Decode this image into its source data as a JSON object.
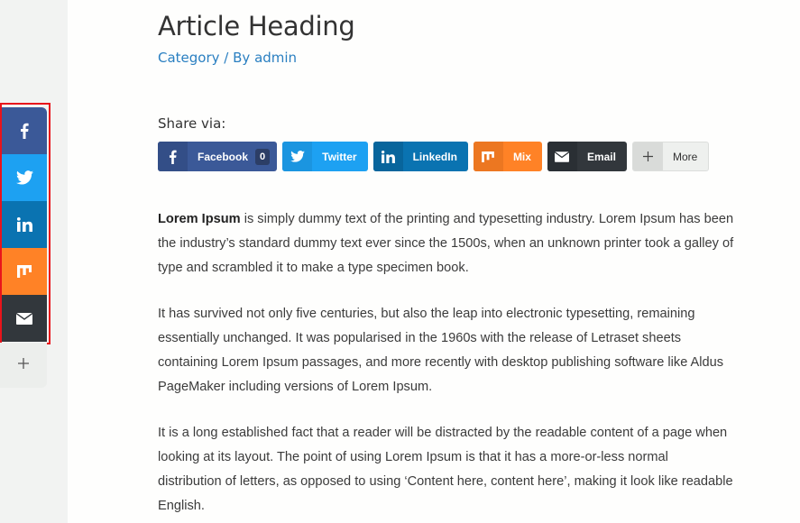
{
  "article": {
    "title": "Article Heading",
    "category": "Category",
    "separator": " / By ",
    "author": "admin"
  },
  "share": {
    "label": "Share via:",
    "buttons": [
      {
        "name": "Facebook",
        "label": "Facebook",
        "count": "0",
        "color": "#3b5998",
        "icon": "facebook-icon"
      },
      {
        "name": "Twitter",
        "label": "Twitter",
        "color": "#1da1f2",
        "icon": "twitter-icon"
      },
      {
        "name": "LinkedIn",
        "label": "LinkedIn",
        "color": "#0a73b1",
        "icon": "linkedin-icon"
      },
      {
        "name": "Mix",
        "label": "Mix",
        "color": "#ff8226",
        "icon": "mix-icon"
      },
      {
        "name": "Email",
        "label": "Email",
        "color": "#32373c",
        "icon": "email-icon"
      },
      {
        "name": "More",
        "label": "More",
        "color": "#eef0ee",
        "icon": "plus-icon"
      }
    ]
  },
  "floating_bar": {
    "buttons": [
      {
        "name": "Facebook",
        "icon": "facebook-icon",
        "color": "#3b5998"
      },
      {
        "name": "Twitter",
        "icon": "twitter-icon",
        "color": "#1da1f2"
      },
      {
        "name": "LinkedIn",
        "icon": "linkedin-icon",
        "color": "#0a73b1"
      },
      {
        "name": "Mix",
        "icon": "mix-icon",
        "color": "#ff8226"
      },
      {
        "name": "Email",
        "icon": "email-icon",
        "color": "#32373c"
      }
    ],
    "more_icon": "plus-icon",
    "highlight_color": "#e8141b"
  },
  "body": {
    "p1_bold": "Lorem Ipsum",
    "p1_rest": " is simply dummy text of the printing and typesetting industry. Lorem Ipsum has been the industry’s standard dummy text ever since the 1500s, when an unknown printer took a galley of type and scrambled it to make a type specimen book.",
    "p2": "It has survived not only five centuries, but also the leap into electronic typesetting, remaining essentially unchanged. It was popularised in the 1960s with the release of Letraset sheets containing Lorem Ipsum passages, and more recently with desktop publishing software like Aldus PageMaker including versions of Lorem Ipsum.",
    "p3": "It is a long established fact that a reader will be distracted by the readable content of a page when looking at its layout. The point of using Lorem Ipsum is that it has a more-or-less normal distribution of letters, as opposed to using ‘Content here, content here’, making it look like readable English."
  }
}
